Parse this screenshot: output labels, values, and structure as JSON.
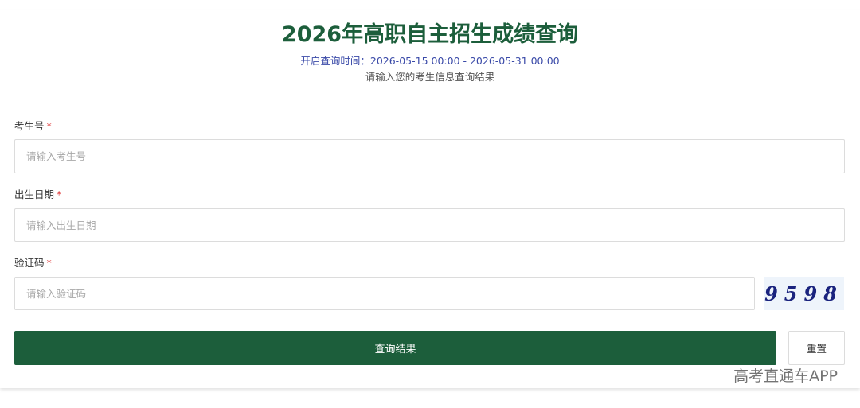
{
  "header": {
    "title": "2026年高职自主招生成绩查询",
    "time_label": "开启查询时间：",
    "time_range": "2026-05-15 00:00 - 2026-05-31 00:00",
    "hint": "请输入您的考生信息查询结果"
  },
  "form": {
    "exam_number": {
      "label": "考生号",
      "required_mark": "*",
      "value": "",
      "placeholder": "请输入考生号"
    },
    "birth_date": {
      "label": "出生日期",
      "required_mark": "*",
      "value": "",
      "placeholder": "请输入出生日期"
    },
    "captcha": {
      "label": "验证码",
      "required_mark": "*",
      "value": "",
      "placeholder": "请输入验证码",
      "image_text": "9598"
    }
  },
  "actions": {
    "submit_label": "查询结果",
    "reset_label": "重置"
  },
  "watermark": "高考直通车APP",
  "colors": {
    "brand_green": "#1c5e3b",
    "time_text": "#3a4aa8",
    "required": "#e03e3e"
  }
}
